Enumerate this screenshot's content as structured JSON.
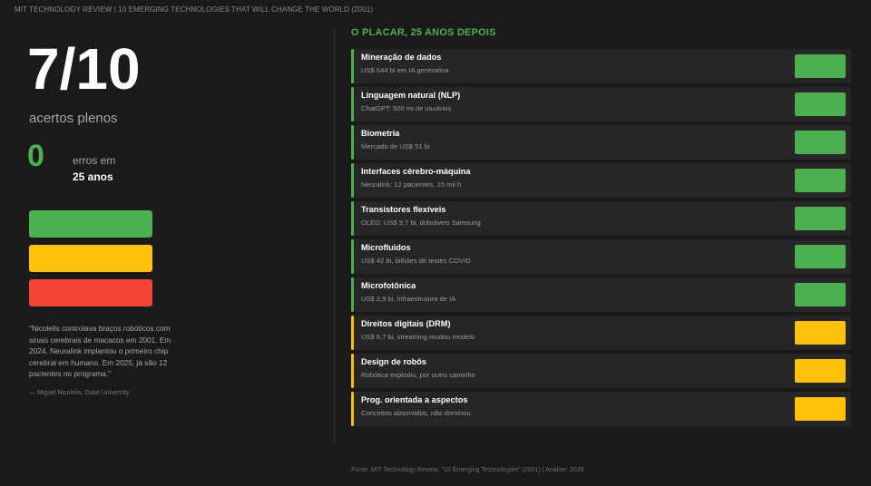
{
  "header": "MIT TECHNOLOGY REVIEW | 10 EMERGING TECHNOLOGIES THAT WILL CHANGE THE WORLD (2001)",
  "summary": {
    "score": "7/10",
    "score_label": "acertos plenos",
    "errors_count": "0",
    "errors_label_line1": "erros em",
    "errors_label_line2": "25 anos"
  },
  "legend_colors": [
    "#4caf50",
    "#ffc107",
    "#f44336"
  ],
  "quote": {
    "text": "\"Nicolelis controlava braços robóticos com sinais cerebrais de macacos em 2001. Em 2024, Neuralink implantou o primeiro chip cerebral em humano. Em 2025, já são 12 pacientes no programa.\"",
    "author": "— Miguel Nicolelis, Duke University"
  },
  "section_title": "O PLACAR, 25 ANOS DEPOIS",
  "status_colors": {
    "hit": "#4caf50",
    "partial": "#ffc107",
    "miss": "#f44336"
  },
  "technologies": [
    {
      "title": "Mineração de dados",
      "subtitle": "US$ 644 bi em IA generativa",
      "status": "hit"
    },
    {
      "title": "Linguagem natural (NLP)",
      "subtitle": "ChatGPT: 500 mi de usuários",
      "status": "hit"
    },
    {
      "title": "Biometria",
      "subtitle": "Mercado de US$ 51 bi",
      "status": "hit"
    },
    {
      "title": "Interfaces cérebro-máquina",
      "subtitle": "Neuralink: 12 pacientes, 15 mil h",
      "status": "hit"
    },
    {
      "title": "Transistores flexíveis",
      "subtitle": "OLED: US$ 9,7 bi, dobráveis Samsung",
      "status": "hit"
    },
    {
      "title": "Microfluidos",
      "subtitle": "US$ 42 bi, bilhões de testes COVID",
      "status": "hit"
    },
    {
      "title": "Microfotônica",
      "subtitle": "US$ 2,9 bi, infraestrutura de IA",
      "status": "hit"
    },
    {
      "title": "Direitos digitais (DRM)",
      "subtitle": "US$ 6,7 bi, streaming mudou modelo",
      "status": "partial"
    },
    {
      "title": "Design de robôs",
      "subtitle": "Robótica explodiu, por outro caminho",
      "status": "partial"
    },
    {
      "title": "Prog. orientada a aspectos",
      "subtitle": "Conceitos absorvidos, não dominou",
      "status": "partial"
    }
  ],
  "footer": "Fonte: MIT Technology Review, \"10 Emerging Technologies\" (2001) | Análise: 2026"
}
